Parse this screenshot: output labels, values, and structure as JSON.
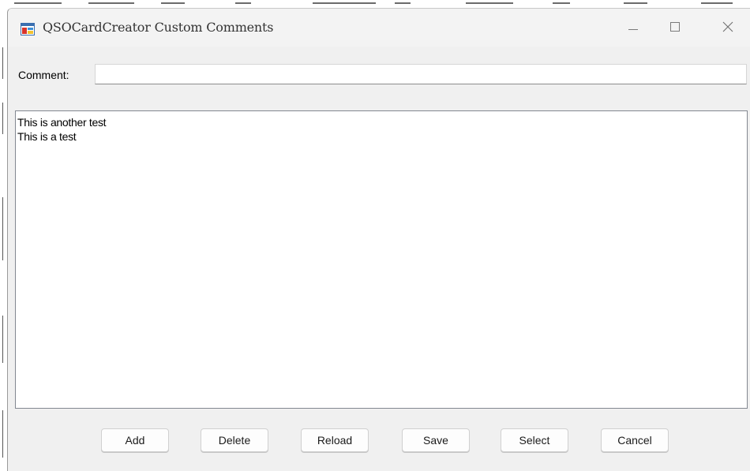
{
  "window": {
    "title": "QSOCardCreator Custom Comments"
  },
  "titlebar_buttons": {
    "minimize_icon": "minimize-icon",
    "maximize_icon": "maximize-icon",
    "close_icon": "close-icon"
  },
  "comment": {
    "label": "Comment:",
    "value": "",
    "placeholder": ""
  },
  "comments_list": {
    "items": [
      "This is another test",
      "This is a test"
    ]
  },
  "buttons": {
    "add": "Add",
    "delete": "Delete",
    "reload": "Reload",
    "save": "Save",
    "select": "Select",
    "cancel": "Cancel"
  },
  "colors": {
    "window_bg": "#f0f0f0",
    "list_bg": "#ffffff",
    "list_border": "#828790"
  }
}
